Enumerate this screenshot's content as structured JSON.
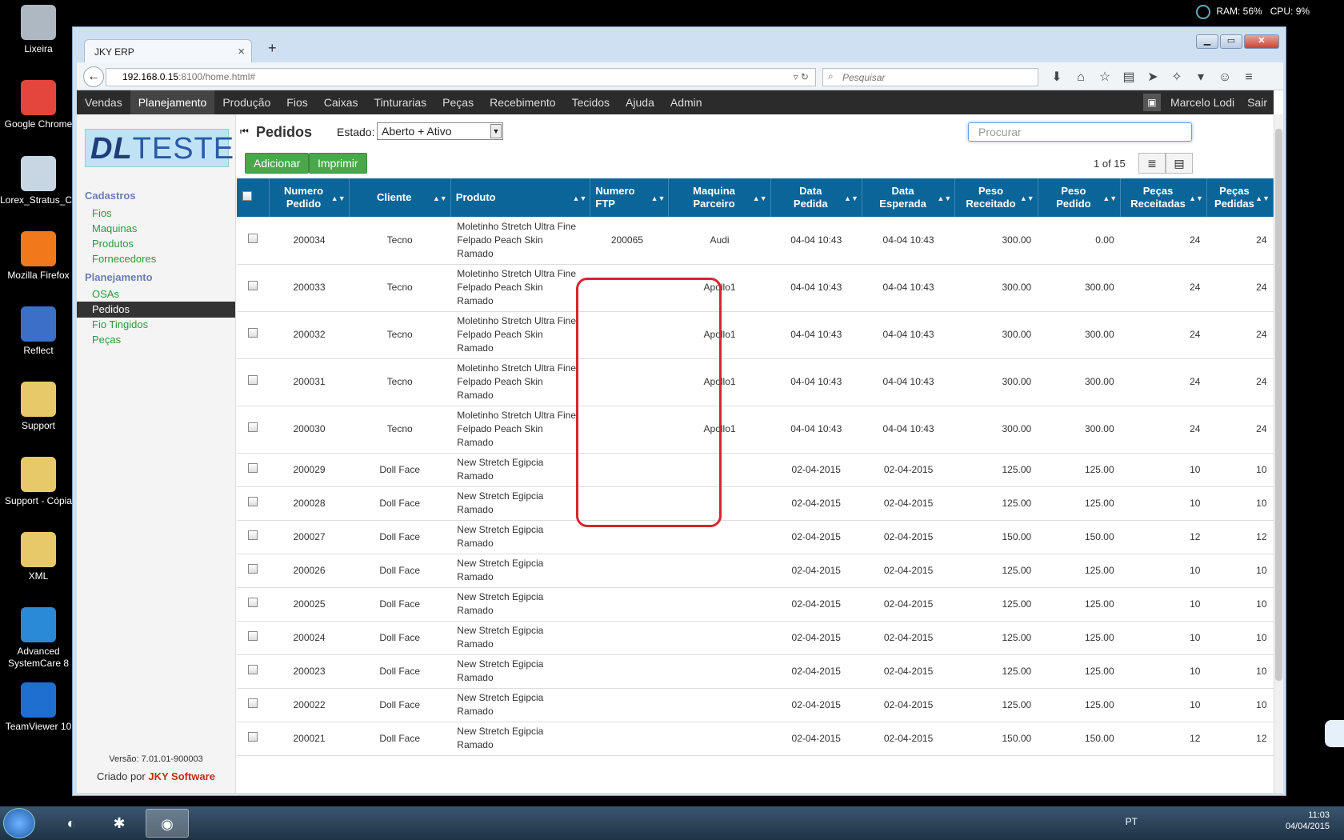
{
  "desktop": {
    "icons": [
      {
        "label": "Lixeira",
        "icon": "recycle-bin-icon",
        "color": "#aeb8c2"
      },
      {
        "label": "Google Chrome",
        "icon": "chrome-icon",
        "color": "#e4463b"
      },
      {
        "label": "Lorex_Stratus_Cl...",
        "icon": "lorex-icon",
        "color": "#c8d6e4"
      },
      {
        "label": "Mozilla Firefox",
        "icon": "firefox-icon",
        "color": "#f07a1a"
      },
      {
        "label": "Reflect",
        "icon": "reflect-icon",
        "color": "#3c6fc8"
      },
      {
        "label": "Support",
        "icon": "folder-icon",
        "color": "#e7c96a"
      },
      {
        "label": "Support - Cópia",
        "icon": "folder-icon",
        "color": "#e7c96a"
      },
      {
        "label": "XML",
        "icon": "folder-icon",
        "color": "#e7c96a"
      },
      {
        "label": "Advanced SystemCare 8",
        "icon": "systemcare-icon",
        "color": "#2a8ad8"
      },
      {
        "label": "TeamViewer 10",
        "icon": "teamviewer-icon",
        "color": "#1f6fd1"
      }
    ],
    "sysmon": {
      "ram": "RAM: 56%",
      "cpu": "CPU: 9%"
    }
  },
  "browser": {
    "tab_title": "JKY ERP",
    "url_host": "192.168.0.15",
    "url_path": ":8100/home.html#",
    "search_placeholder": "Pesquisar"
  },
  "menu": {
    "items": [
      "Vendas",
      "Planejamento",
      "Produção",
      "Fios",
      "Caixas",
      "Tinturarias",
      "Peças",
      "Recebimento",
      "Tecidos",
      "Ajuda",
      "Admin"
    ],
    "active": "Planejamento",
    "user": "Marcelo Lodi",
    "logout": "Sair"
  },
  "sidebar": {
    "logo_dl": "DL",
    "logo_teste": "TESTE",
    "cadastros_title": "Cadastros",
    "cadastros": [
      "Fios",
      "Maquinas",
      "Produtos",
      "Fornecedores"
    ],
    "planejamento_title": "Planejamento",
    "planejamento": [
      "OSAs",
      "Pedidos",
      "Fio Tingidos",
      "Peças"
    ],
    "selected": "Pedidos",
    "version": "Versão: 7.01.01-900003",
    "credits_prefix": "Criado por ",
    "credits_brand": "JKY Software"
  },
  "main": {
    "title": "Pedidos",
    "estado_label": "Estado:",
    "estado_value": "Aberto + Ativo",
    "search_placeholder": "Procurar",
    "add_label": "Adicionar",
    "print_label": "Imprimir",
    "page_info": "1 of 15"
  },
  "table": {
    "columns": [
      {
        "key": "numero",
        "label": [
          "Numero",
          "Pedido"
        ],
        "align": "c"
      },
      {
        "key": "cliente",
        "label": [
          "Cliente"
        ],
        "align": "c"
      },
      {
        "key": "produto",
        "label": [
          "Produto"
        ],
        "align": "l"
      },
      {
        "key": "ftp",
        "label": [
          "Numero",
          "FTP"
        ],
        "align": "l"
      },
      {
        "key": "maquina",
        "label": [
          "Maquina",
          "Parceiro"
        ],
        "align": "c"
      },
      {
        "key": "data_pedida",
        "label": [
          "Data",
          "Pedida"
        ],
        "align": "c"
      },
      {
        "key": "data_esperada",
        "label": [
          "Data",
          "Esperada"
        ],
        "align": "c"
      },
      {
        "key": "peso_receitado",
        "label": [
          "Peso",
          "Receitado"
        ],
        "align": "r"
      },
      {
        "key": "peso_pedido",
        "label": [
          "Peso",
          "Pedido"
        ],
        "align": "r"
      },
      {
        "key": "pecas_receitadas",
        "label": [
          "Peças",
          "Receitadas"
        ],
        "align": "r"
      },
      {
        "key": "pecas_pedidas",
        "label": [
          "Peças",
          "Pedidas"
        ],
        "align": "r"
      }
    ],
    "rows": [
      {
        "numero": "200034",
        "cliente": "Tecno",
        "produto": [
          "Moletinho Stretch Ultra Fine",
          "Felpado Peach Skin",
          "Ramado"
        ],
        "ftp": "200065",
        "maquina": "Audi",
        "data_pedida": "04-04 10:43",
        "data_esperada": "04-04 10:43",
        "peso_receitado": "300.00",
        "peso_pedido": "0.00",
        "pecas_receitadas": "24",
        "pecas_pedidas": "24"
      },
      {
        "numero": "200033",
        "cliente": "Tecno",
        "produto": [
          "Moletinho Stretch Ultra Fine",
          "Felpado Peach Skin",
          "Ramado"
        ],
        "ftp": "",
        "maquina": "Apollo1",
        "data_pedida": "04-04 10:43",
        "data_esperada": "04-04 10:43",
        "peso_receitado": "300.00",
        "peso_pedido": "300.00",
        "pecas_receitadas": "24",
        "pecas_pedidas": "24"
      },
      {
        "numero": "200032",
        "cliente": "Tecno",
        "produto": [
          "Moletinho Stretch Ultra Fine",
          "Felpado Peach Skin",
          "Ramado"
        ],
        "ftp": "",
        "maquina": "Apollo1",
        "data_pedida": "04-04 10:43",
        "data_esperada": "04-04 10:43",
        "peso_receitado": "300.00",
        "peso_pedido": "300.00",
        "pecas_receitadas": "24",
        "pecas_pedidas": "24"
      },
      {
        "numero": "200031",
        "cliente": "Tecno",
        "produto": [
          "Moletinho Stretch Ultra Fine",
          "Felpado Peach Skin",
          "Ramado"
        ],
        "ftp": "",
        "maquina": "Apollo1",
        "data_pedida": "04-04 10:43",
        "data_esperada": "04-04 10:43",
        "peso_receitado": "300.00",
        "peso_pedido": "300.00",
        "pecas_receitadas": "24",
        "pecas_pedidas": "24"
      },
      {
        "numero": "200030",
        "cliente": "Tecno",
        "produto": [
          "Moletinho Stretch Ultra Fine",
          "Felpado Peach Skin",
          "Ramado"
        ],
        "ftp": "",
        "maquina": "Apollo1",
        "data_pedida": "04-04 10:43",
        "data_esperada": "04-04 10:43",
        "peso_receitado": "300.00",
        "peso_pedido": "300.00",
        "pecas_receitadas": "24",
        "pecas_pedidas": "24"
      },
      {
        "numero": "200029",
        "cliente": "Doll Face",
        "produto": [
          "New Stretch Egipcia",
          "Ramado"
        ],
        "ftp": "",
        "maquina": "",
        "data_pedida": "02-04-2015",
        "data_esperada": "02-04-2015",
        "peso_receitado": "125.00",
        "peso_pedido": "125.00",
        "pecas_receitadas": "10",
        "pecas_pedidas": "10"
      },
      {
        "numero": "200028",
        "cliente": "Doll Face",
        "produto": [
          "New Stretch Egipcia",
          "Ramado"
        ],
        "ftp": "",
        "maquina": "",
        "data_pedida": "02-04-2015",
        "data_esperada": "02-04-2015",
        "peso_receitado": "125.00",
        "peso_pedido": "125.00",
        "pecas_receitadas": "10",
        "pecas_pedidas": "10"
      },
      {
        "numero": "200027",
        "cliente": "Doll Face",
        "produto": [
          "New Stretch Egipcia",
          "Ramado"
        ],
        "ftp": "",
        "maquina": "",
        "data_pedida": "02-04-2015",
        "data_esperada": "02-04-2015",
        "peso_receitado": "150.00",
        "peso_pedido": "150.00",
        "pecas_receitadas": "12",
        "pecas_pedidas": "12"
      },
      {
        "numero": "200026",
        "cliente": "Doll Face",
        "produto": [
          "New Stretch Egipcia",
          "Ramado"
        ],
        "ftp": "",
        "maquina": "",
        "data_pedida": "02-04-2015",
        "data_esperada": "02-04-2015",
        "peso_receitado": "125.00",
        "peso_pedido": "125.00",
        "pecas_receitadas": "10",
        "pecas_pedidas": "10"
      },
      {
        "numero": "200025",
        "cliente": "Doll Face",
        "produto": [
          "New Stretch Egipcia",
          "Ramado"
        ],
        "ftp": "",
        "maquina": "",
        "data_pedida": "02-04-2015",
        "data_esperada": "02-04-2015",
        "peso_receitado": "125.00",
        "peso_pedido": "125.00",
        "pecas_receitadas": "10",
        "pecas_pedidas": "10"
      },
      {
        "numero": "200024",
        "cliente": "Doll Face",
        "produto": [
          "New Stretch Egipcia",
          "Ramado"
        ],
        "ftp": "",
        "maquina": "",
        "data_pedida": "02-04-2015",
        "data_esperada": "02-04-2015",
        "peso_receitado": "125.00",
        "peso_pedido": "125.00",
        "pecas_receitadas": "10",
        "pecas_pedidas": "10"
      },
      {
        "numero": "200023",
        "cliente": "Doll Face",
        "produto": [
          "New Stretch Egipcia",
          "Ramado"
        ],
        "ftp": "",
        "maquina": "",
        "data_pedida": "02-04-2015",
        "data_esperada": "02-04-2015",
        "peso_receitado": "125.00",
        "peso_pedido": "125.00",
        "pecas_receitadas": "10",
        "pecas_pedidas": "10"
      },
      {
        "numero": "200022",
        "cliente": "Doll Face",
        "produto": [
          "New Stretch Egipcia",
          "Ramado"
        ],
        "ftp": "",
        "maquina": "",
        "data_pedida": "02-04-2015",
        "data_esperada": "02-04-2015",
        "peso_receitado": "125.00",
        "peso_pedido": "125.00",
        "pecas_receitadas": "10",
        "pecas_pedidas": "10"
      },
      {
        "numero": "200021",
        "cliente": "Doll Face",
        "produto": [
          "New Stretch Egipcia",
          "Ramado"
        ],
        "ftp": "",
        "maquina": "",
        "data_pedida": "02-04-2015",
        "data_esperada": "02-04-2015",
        "peso_receitado": "150.00",
        "peso_pedido": "150.00",
        "pecas_receitadas": "12",
        "pecas_pedidas": "12"
      }
    ]
  },
  "taskbar": {
    "lang": "PT",
    "time": "11:03",
    "date": "04/04/2015"
  },
  "colors": {
    "header_blue": "#0a6599",
    "highlight_red": "#d9242f",
    "link_green": "#2c9a3c",
    "button_green": "#4aa84a"
  }
}
